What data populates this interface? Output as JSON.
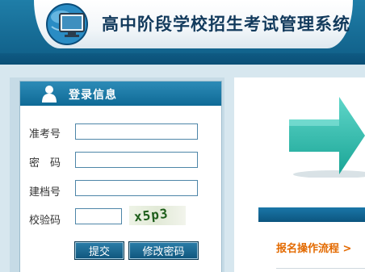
{
  "header": {
    "app_title": "高中阶段学校招生考试管理系统",
    "logo_icon": "monitor-globe-icon"
  },
  "login": {
    "title": "登录信息",
    "title_icon": "user-icon",
    "fields": {
      "exam_no": {
        "label": "准考号",
        "value": ""
      },
      "password": {
        "label": "密　码",
        "value": ""
      },
      "record_no": {
        "label": "建档号",
        "value": ""
      },
      "captcha": {
        "label": "校验码",
        "value": "",
        "image_text": "x5p3"
      }
    },
    "submit_label": "提交",
    "change_password_label": "修改密码"
  },
  "content": {
    "arrow_icon": "right-arrow-icon",
    "flow_link": "报名操作流程 >"
  },
  "colors": {
    "header_blue": "#1f7ea8",
    "panel_title": "#0f6a96",
    "button": "#0f557c",
    "link_orange": "#e36a00",
    "arrow_teal": "#2dbdb0",
    "background": "#d7e7ef"
  }
}
